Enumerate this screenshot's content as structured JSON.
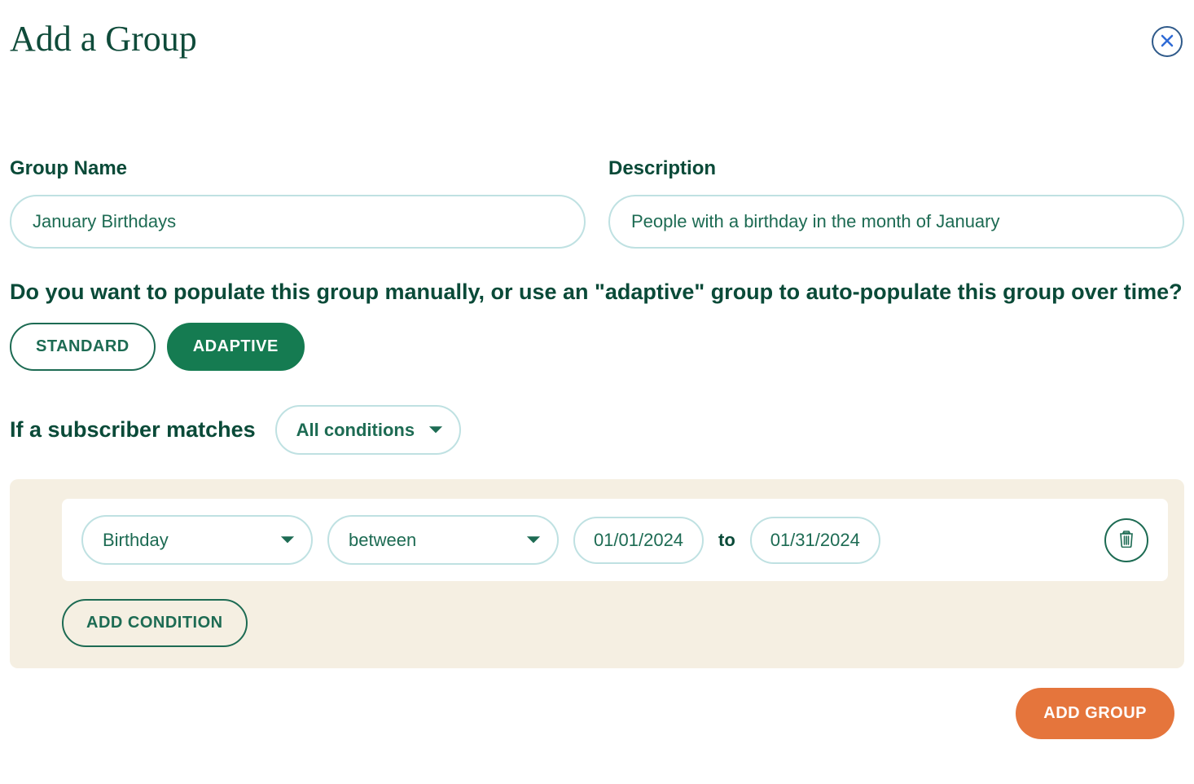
{
  "modal": {
    "title": "Add a Group"
  },
  "fields": {
    "group_name_label": "Group Name",
    "group_name_value": "January Birthdays",
    "description_label": "Description",
    "description_value": "People with a birthday in the month of January"
  },
  "type_question": "Do you want to populate this group manually, or use an \"adaptive\" group to auto-populate this group over time?",
  "type_buttons": {
    "standard": "STANDARD",
    "adaptive": "ADAPTIVE",
    "selected": "adaptive"
  },
  "match": {
    "prefix": "If a subscriber matches",
    "selected": "All conditions"
  },
  "condition": {
    "field": "Birthday",
    "operator": "between",
    "date_from": "01/01/2024",
    "to_label": "to",
    "date_to": "01/31/2024"
  },
  "buttons": {
    "add_condition": "ADD CONDITION",
    "submit": "ADD GROUP"
  }
}
